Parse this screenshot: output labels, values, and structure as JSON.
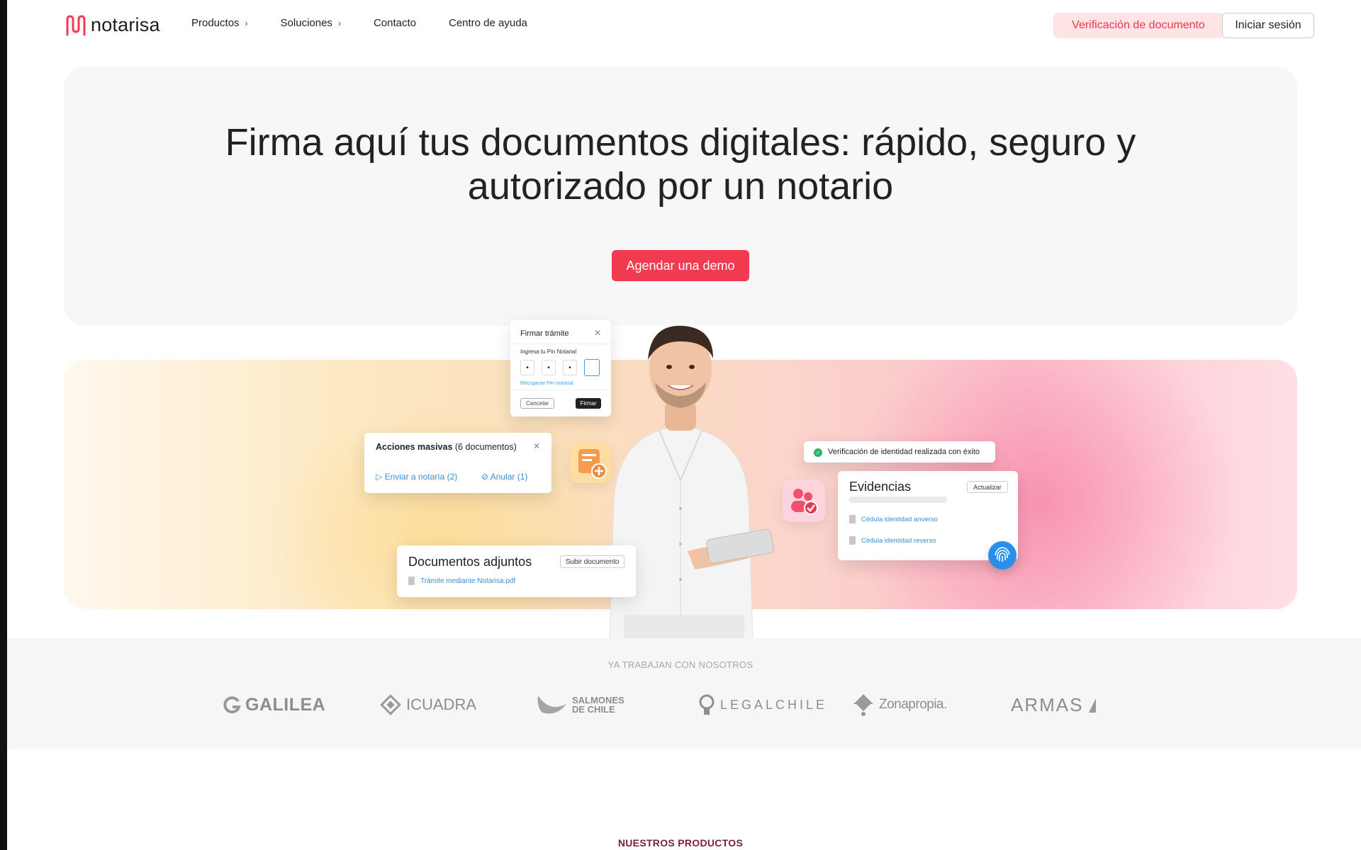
{
  "nav": {
    "logo_text": "notarisa",
    "links": [
      {
        "label": "Productos",
        "has_chevron": true
      },
      {
        "label": "Soluciones",
        "has_chevron": true
      },
      {
        "label": "Contacto",
        "has_chevron": false
      },
      {
        "label": "Centro de ayuda",
        "has_chevron": false
      }
    ],
    "chevron": "›",
    "verify_label": "Verificación de documento",
    "login_label": "Iniciar sesión"
  },
  "hero": {
    "title_line1": "Firma aquí tus documentos digitales: rápido, seguro y",
    "title_line2": "autorizado por un notario",
    "cta_label": "Agendar una demo"
  },
  "cards": {
    "firmar": {
      "title": "Firmar trámite",
      "pin_label": "Ingresa tu Pin Notarial",
      "pin_digits": [
        "•",
        "•",
        "•",
        ""
      ],
      "recover_label": "Recuperar Pin notarial",
      "cancel_label": "Cancelar",
      "sign_label": "Firmar"
    },
    "acciones": {
      "title_bold": "Acciones masivas",
      "title_rest": " (6 documentos)",
      "action1": "Enviar a notaría (2)",
      "action2": "Anular (1)"
    },
    "verificacion": {
      "text": "Verificación de identidad realizada con éxito"
    },
    "evidencias": {
      "title": "Evidencias",
      "update_label": "Actualizar",
      "files": [
        "Cédula identidad anverso",
        "Cédula identidad reverso"
      ]
    },
    "documentos": {
      "title": "Documentos adjuntos",
      "upload_label": "Subir documento",
      "file": "Trámite mediante Notarisa.pdf"
    }
  },
  "clients": {
    "label": "YA TRABAJAN CON NOSOTROS",
    "logos": [
      {
        "name": "GALILEA"
      },
      {
        "name": "ICUADRA"
      },
      {
        "name_line1": "SALMONES",
        "name_line2": "DE CHILE"
      },
      {
        "name": "LEGALCHILE"
      },
      {
        "name": "Zonapropia."
      },
      {
        "name": "ARMAS"
      }
    ]
  },
  "products": {
    "label": "NUESTROS PRODUCTOS"
  },
  "colors": {
    "brand": "#f23a51",
    "link": "#3a8fd6",
    "success": "#2fb36a",
    "products_label": "#7a1d47"
  },
  "icons": [
    "x-icon",
    "send-icon",
    "cancel-circle-icon",
    "document-add-icon",
    "person-check-icon",
    "check-circle-icon",
    "file-icon",
    "fingerprint-icon",
    "chevron-right-icon"
  ]
}
